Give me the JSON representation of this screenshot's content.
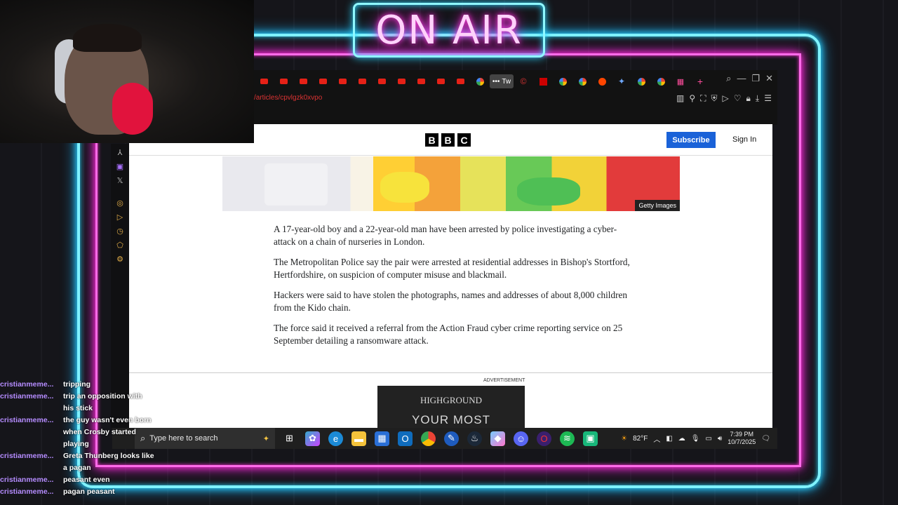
{
  "overlay": {
    "sign_text": "ON AIR"
  },
  "browser": {
    "active_tab_label": "Tw",
    "address": "/articles/cpvlgzk0xvpo"
  },
  "bbc": {
    "logo_letters": [
      "B",
      "B",
      "C"
    ],
    "subscribe_label": "Subscribe",
    "signin_label": "Sign In",
    "image_credit": "Getty Images",
    "paragraphs": [
      "A 17-year-old boy and a 22-year-old man have been arrested by police investigating a cyber-attack on a chain of nurseries in London.",
      "The Metropolitan Police say the pair were arrested at residential addresses in Bishop's Stortford, Hertfordshire, on suspicion of computer misuse and blackmail.",
      "Hackers were said to have stolen the photographs, names and addresses of about 8,000 children from the Kido chain.",
      "The force said it received a referral from the Action Fraud cyber crime reporting service on 25 September detailing a ransomware attack."
    ],
    "ad_label": "ADVERTISEMENT",
    "ad_brand": "HIGHGROUND",
    "ad_headline": "YOUR MOST"
  },
  "taskbar": {
    "search_placeholder": "Type here to search",
    "weather": "82°F",
    "time": "7:39 PM",
    "date": "10/7/2025"
  },
  "chat": [
    {
      "user": "cristianmeme...",
      "message": "tripping"
    },
    {
      "user": "cristianmeme...",
      "message": "trip an opposition with his stick"
    },
    {
      "user": "cristianmeme...",
      "message": "the guy wasn't even born when Crosby started playing"
    },
    {
      "user": "cristianmeme...",
      "message": "Greta Thunberg looks like a pagan"
    },
    {
      "user": "cristianmeme...",
      "message": "peasant even"
    },
    {
      "user": "cristianmeme...",
      "message": "pagan peasant"
    }
  ],
  "colors": {
    "neon_cyan": "#7ff3ff",
    "neon_pink": "#ff6be9",
    "bbc_blue": "#1a62d8",
    "chat_user": "#b58cff"
  }
}
